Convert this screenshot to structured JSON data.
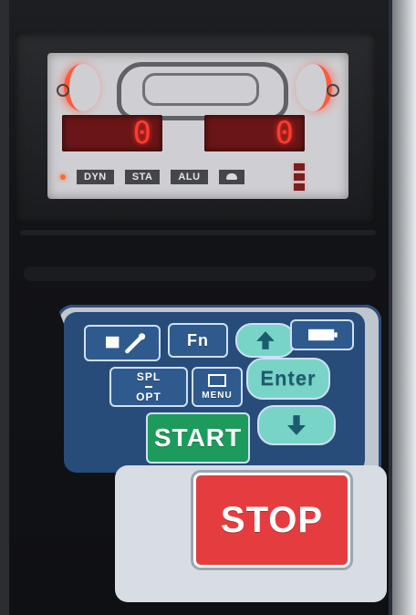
{
  "display": {
    "left_value": "0",
    "right_value": "0",
    "mode_buttons": [
      "DYN",
      "STA",
      "ALU"
    ]
  },
  "keypad": {
    "fn_label": "Fn",
    "spl": "SPL",
    "opt": "OPT",
    "menu": "MENU",
    "enter": "Enter",
    "start": "START",
    "stop": "STOP"
  },
  "colors": {
    "keypad_blue": "#274c79",
    "keypad_teal": "#79d4c8",
    "start_green": "#1c9b5c",
    "stop_red": "#e53d3f",
    "led_red": "#ff3b2f"
  }
}
